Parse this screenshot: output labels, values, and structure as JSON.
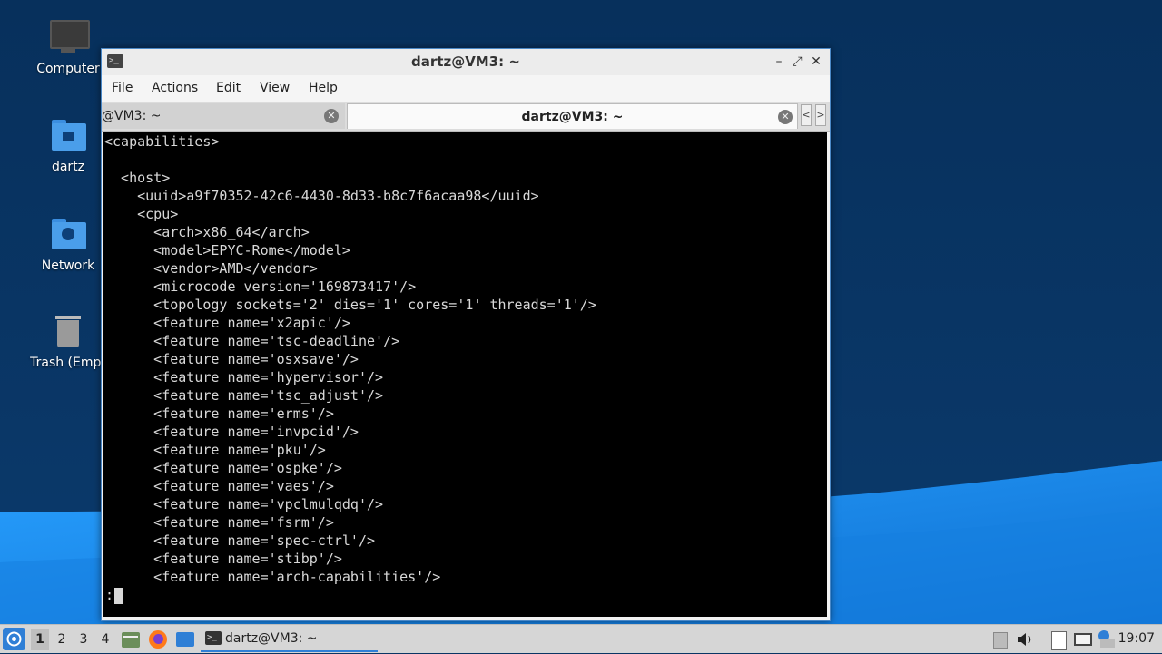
{
  "desktop": {
    "icons": [
      {
        "label": "Computer"
      },
      {
        "label": "dartz"
      },
      {
        "label": "Network"
      },
      {
        "label": "Trash (Empt"
      }
    ]
  },
  "window": {
    "title": "dartz@VM3: ~",
    "buttons": {
      "minimize": "–",
      "maximize": "⤢",
      "close": "✕"
    },
    "menu": [
      "File",
      "Actions",
      "Edit",
      "View",
      "Help"
    ],
    "tabs": [
      {
        "label": "@VM3: ~",
        "active": false
      },
      {
        "label": "dartz@VM3: ~",
        "active": true
      }
    ],
    "tab_scroll": {
      "left": "<",
      "right": ">"
    }
  },
  "terminal": {
    "lines": [
      "<capabilities>",
      "",
      "  <host>",
      "    <uuid>a9f70352-42c6-4430-8d33-b8c7f6acaa98</uuid>",
      "    <cpu>",
      "      <arch>x86_64</arch>",
      "      <model>EPYC-Rome</model>",
      "      <vendor>AMD</vendor>",
      "      <microcode version='169873417'/>",
      "      <topology sockets='2' dies='1' cores='1' threads='1'/>",
      "      <feature name='x2apic'/>",
      "      <feature name='tsc-deadline'/>",
      "      <feature name='osxsave'/>",
      "      <feature name='hypervisor'/>",
      "      <feature name='tsc_adjust'/>",
      "      <feature name='erms'/>",
      "      <feature name='invpcid'/>",
      "      <feature name='pku'/>",
      "      <feature name='ospke'/>",
      "      <feature name='vaes'/>",
      "      <feature name='vpclmulqdq'/>",
      "      <feature name='fsrm'/>",
      "      <feature name='spec-ctrl'/>",
      "      <feature name='stibp'/>",
      "      <feature name='arch-capabilities'/>"
    ],
    "prompt": ":"
  },
  "taskbar": {
    "workspaces": [
      "1",
      "2",
      "3",
      "4"
    ],
    "active_workspace": "1",
    "task_label": "dartz@VM3: ~",
    "clock": "19:07"
  },
  "colors": {
    "desktop_dark": "#0a3564",
    "desktop_wave": "#1a8ae8",
    "accent": "#2f7fd6",
    "terminal_bg": "#000000",
    "terminal_fg": "#d8d8d8"
  }
}
